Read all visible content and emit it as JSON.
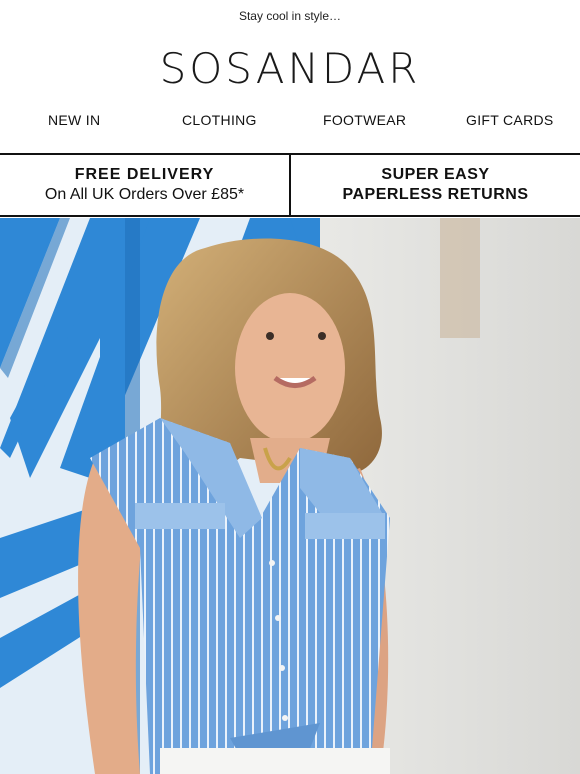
{
  "preheader": {
    "text": "Stay cool in style…"
  },
  "brand": {
    "logo_text": "SOSANDAR"
  },
  "nav": {
    "items": [
      {
        "label": "NEW IN"
      },
      {
        "label": "CLOTHING"
      },
      {
        "label": "FOOTWEAR"
      },
      {
        "label": "GIFT CARDS"
      }
    ]
  },
  "usp": {
    "delivery": {
      "title": "FREE DELIVERY",
      "subtitle": "On All UK Orders Over £85*"
    },
    "returns": {
      "line1": "SUPER EASY",
      "line2": "PAPERLESS RETURNS"
    }
  },
  "hero": {
    "image": "woman-in-blue-striped-shirt",
    "colors": {
      "shirt": "#6ea3dd",
      "railing": "#2f88d6",
      "wall": "#ececea",
      "hair": "#b8905a",
      "skin": "#e8b594"
    }
  }
}
